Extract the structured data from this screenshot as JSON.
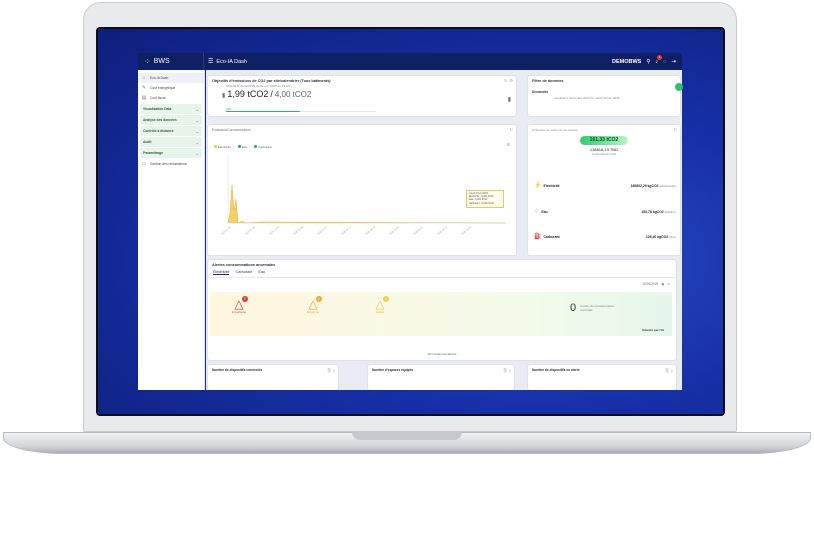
{
  "app": {
    "logo_text": "BWS",
    "title": "Eco-IA Dash",
    "user": "DEMOBWS",
    "notification_count": "1"
  },
  "sidebar": {
    "items": [
      {
        "label": "Eco-IA Dash",
        "icon": "home-icon"
      },
      {
        "label": "Coût énérgétique",
        "icon": "pen-icon"
      },
      {
        "label": "Coût fiscal",
        "icon": "building-icon"
      }
    ],
    "sections": [
      {
        "label": "Visualisation Data"
      },
      {
        "label": "Analyse des données"
      },
      {
        "label": "Contrôle à distance"
      },
      {
        "label": "Audit"
      },
      {
        "label": "Paramétrage"
      }
    ],
    "footer_item": {
      "label": "Gestion des réclamations",
      "icon": "message-icon"
    }
  },
  "objectives": {
    "title": "Objectifs d'émissions de CO2 par site/calendrier (Tous bâtiments)",
    "subtitle": "Objectif le 31/12/2025 du 01 oct. 2025 au 31 oct...",
    "current": "1,99 tCO2",
    "separator": "/",
    "target": "4,00 tCO2",
    "progress_label": "49%",
    "progress_value": 0.49
  },
  "filter": {
    "title": "Filtre de données",
    "label": "Demandés",
    "range": "vendredi 1 novembre 2024 Au mardi 10 juin 2025"
  },
  "consumption_chart": {
    "title": "Emissions/Consommations",
    "legend": [
      {
        "name": "Électricité",
        "color": "#f2c94c"
      },
      {
        "name": "Eau",
        "color": "#2f80ed"
      },
      {
        "name": "Carburant",
        "color": "#27ae60"
      }
    ],
    "tooltip": [
      "Lundi 4 Nov 2024",
      "Electricité : 0,031 tCO2",
      "Eau : 0,001 tCO2",
      "Carburant : 0,002 tCO2"
    ]
  },
  "emissions_summary": {
    "title": "Emissions de Carbone par activité",
    "badge": "161,33 tCO2",
    "cost": "138618,13 TND",
    "cost_label": "Coût total du CO2",
    "rows": [
      {
        "label": "Electricité",
        "value": "160802,29 kgCO2",
        "unit": "(kilokilowatt)"
      },
      {
        "label": "Eau",
        "value": "153,78 kgCO2",
        "unit": "(kilolitre)"
      },
      {
        "label": "Carburant",
        "value": "128,40 kgCO2",
        "unit": "(litre)"
      }
    ]
  },
  "alerts": {
    "title": "Alertes consommations anormales",
    "tabs": [
      "Électricité",
      "Carburant",
      "Eau"
    ],
    "active_tab": "Électricité",
    "date": "10/06/2025",
    "levels": [
      {
        "label": "Importante",
        "count": "0",
        "color": "#e53935"
      },
      {
        "label": "Moyenne",
        "count": "0",
        "color": "#f2a532"
      },
      {
        "label": "Faible",
        "count": "0",
        "color": "#f2c94c"
      }
    ],
    "anomaly_count": "0",
    "anomaly_label": "Conso. de consommation anormale",
    "detected_by": "Détecté par l'IA",
    "footer_link": "Voir toutes les alertes"
  },
  "stat_cards": [
    {
      "title": "Nombre de dispositifs connectés"
    },
    {
      "title": "Nombre d'espaces équipés"
    },
    {
      "title": "Nombre de dispositifs en alerte"
    }
  ]
}
